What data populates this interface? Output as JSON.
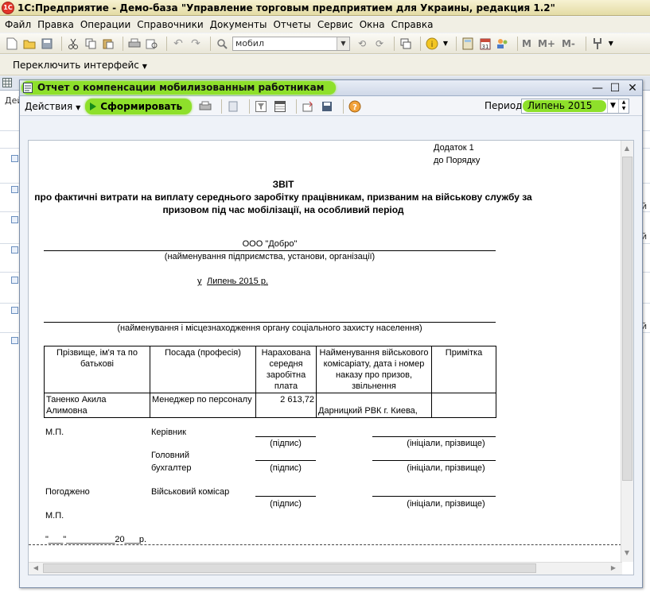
{
  "app": {
    "title": "1С:Предприятие - Демо-база \"Управление торговым предприятием для Украины, редакция 1.2\"",
    "logo": "1C"
  },
  "menu": [
    "Файл",
    "Правка",
    "Операции",
    "Справочники",
    "Документы",
    "Отчеты",
    "Сервис",
    "Окна",
    "Справка"
  ],
  "toolbar": {
    "search_value": "мобил",
    "m_buttons": [
      "M",
      "M+",
      "M-"
    ]
  },
  "switch_interface": "Переключить интерфейс",
  "background": {
    "tab_label": "Дей",
    "right_fragments": [
      "й",
      "й",
      "й"
    ]
  },
  "report_window": {
    "title": "Отчет о компенсации мобилизованным работникам",
    "actions_label": "Действия",
    "generate_label": "Сформировать",
    "period_label": "Период:",
    "period_value": "Липень 2015"
  },
  "report": {
    "appendix_line1": "Додаток 1",
    "appendix_line2": "до Порядку",
    "title": "ЗВІТ",
    "subtitle_line1": "про фактичні витрати на виплату середнього заробітку працівникам, призваним на військову службу за",
    "subtitle_line2": "призовом під час мобілізації, на особливий період",
    "org_name": "ООО \"Добро\"",
    "org_caption": "(найменування підприємства, установи, організації)",
    "period_prefix": "у",
    "period_text": "Липень 2015 р.",
    "social_caption": "(найменування і місцезнаходження органу соціального захисту населення)",
    "columns": [
      "Прізвище, ім'я та по батькові",
      "Посада (професія)",
      "Нарахована середня заробітна плата",
      "Найменування військового комісаріату, дата і номер наказу про призов, звільнення",
      "Примітка"
    ],
    "rows": [
      {
        "name": "Таненко Акила Алимовна",
        "position": "Менеджер по персоналу",
        "salary": "2 613,72",
        "commissariat": "Дарницкий РВК г. Киева,",
        "note": ""
      }
    ],
    "mp1": "М.П.",
    "director_label": "Керівник",
    "sign_caption": "(підпис)",
    "initials_caption": "(ініціали, прізвище)",
    "chief_acc_line1": "Головний",
    "chief_acc_line2": "бухгалтер",
    "agreed_label": "Погоджено",
    "commissar_label": "Військовий комісар",
    "mp2": "М.П.",
    "date_line": "\"___\"__________20___р."
  }
}
